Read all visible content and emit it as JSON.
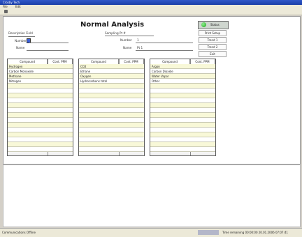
{
  "window": {
    "title": "Crosby Tech",
    "menu": [
      "File",
      "Edit"
    ]
  },
  "header": {
    "page_title": "Normal Analysis",
    "description_label": "Description Field",
    "number_label": "Number",
    "name_label": "Name",
    "sampling_point_label": "Sampling Pt #",
    "sp_number_label": "Number",
    "sp_number_value": "1",
    "sp_name_label": "Name",
    "sp_name_value": "Pt 1"
  },
  "controls": {
    "status_label": "Status",
    "buttons": [
      "Print Setup",
      "Trend 1",
      "Trend 2",
      "Exit"
    ]
  },
  "tables": [
    {
      "headers": [
        "Compound",
        "Cont. PPM"
      ],
      "rows": [
        [
          "Hydrogen",
          ""
        ],
        [
          "Carbon Monoxide",
          ""
        ],
        [
          "Methane",
          ""
        ],
        [
          "Nitrogen",
          ""
        ]
      ]
    },
    {
      "headers": [
        "Compound",
        "Cont. PPM"
      ],
      "rows": [
        [
          "CO2",
          ""
        ],
        [
          "Ethane",
          ""
        ],
        [
          "Oxygen",
          ""
        ],
        [
          "Hydrocarbons total",
          ""
        ]
      ]
    },
    {
      "headers": [
        "Compound",
        "Cont. PPM"
      ],
      "rows": [
        [
          "Argon",
          ""
        ],
        [
          "Carbon Dioxide",
          ""
        ],
        [
          "Water Vapor",
          ""
        ],
        [
          "Other",
          ""
        ]
      ]
    }
  ],
  "statusbar": {
    "left_text": "Communications Offline",
    "right_text": "Time remaining 00:00:00   20.01.2006   07:07:41"
  }
}
